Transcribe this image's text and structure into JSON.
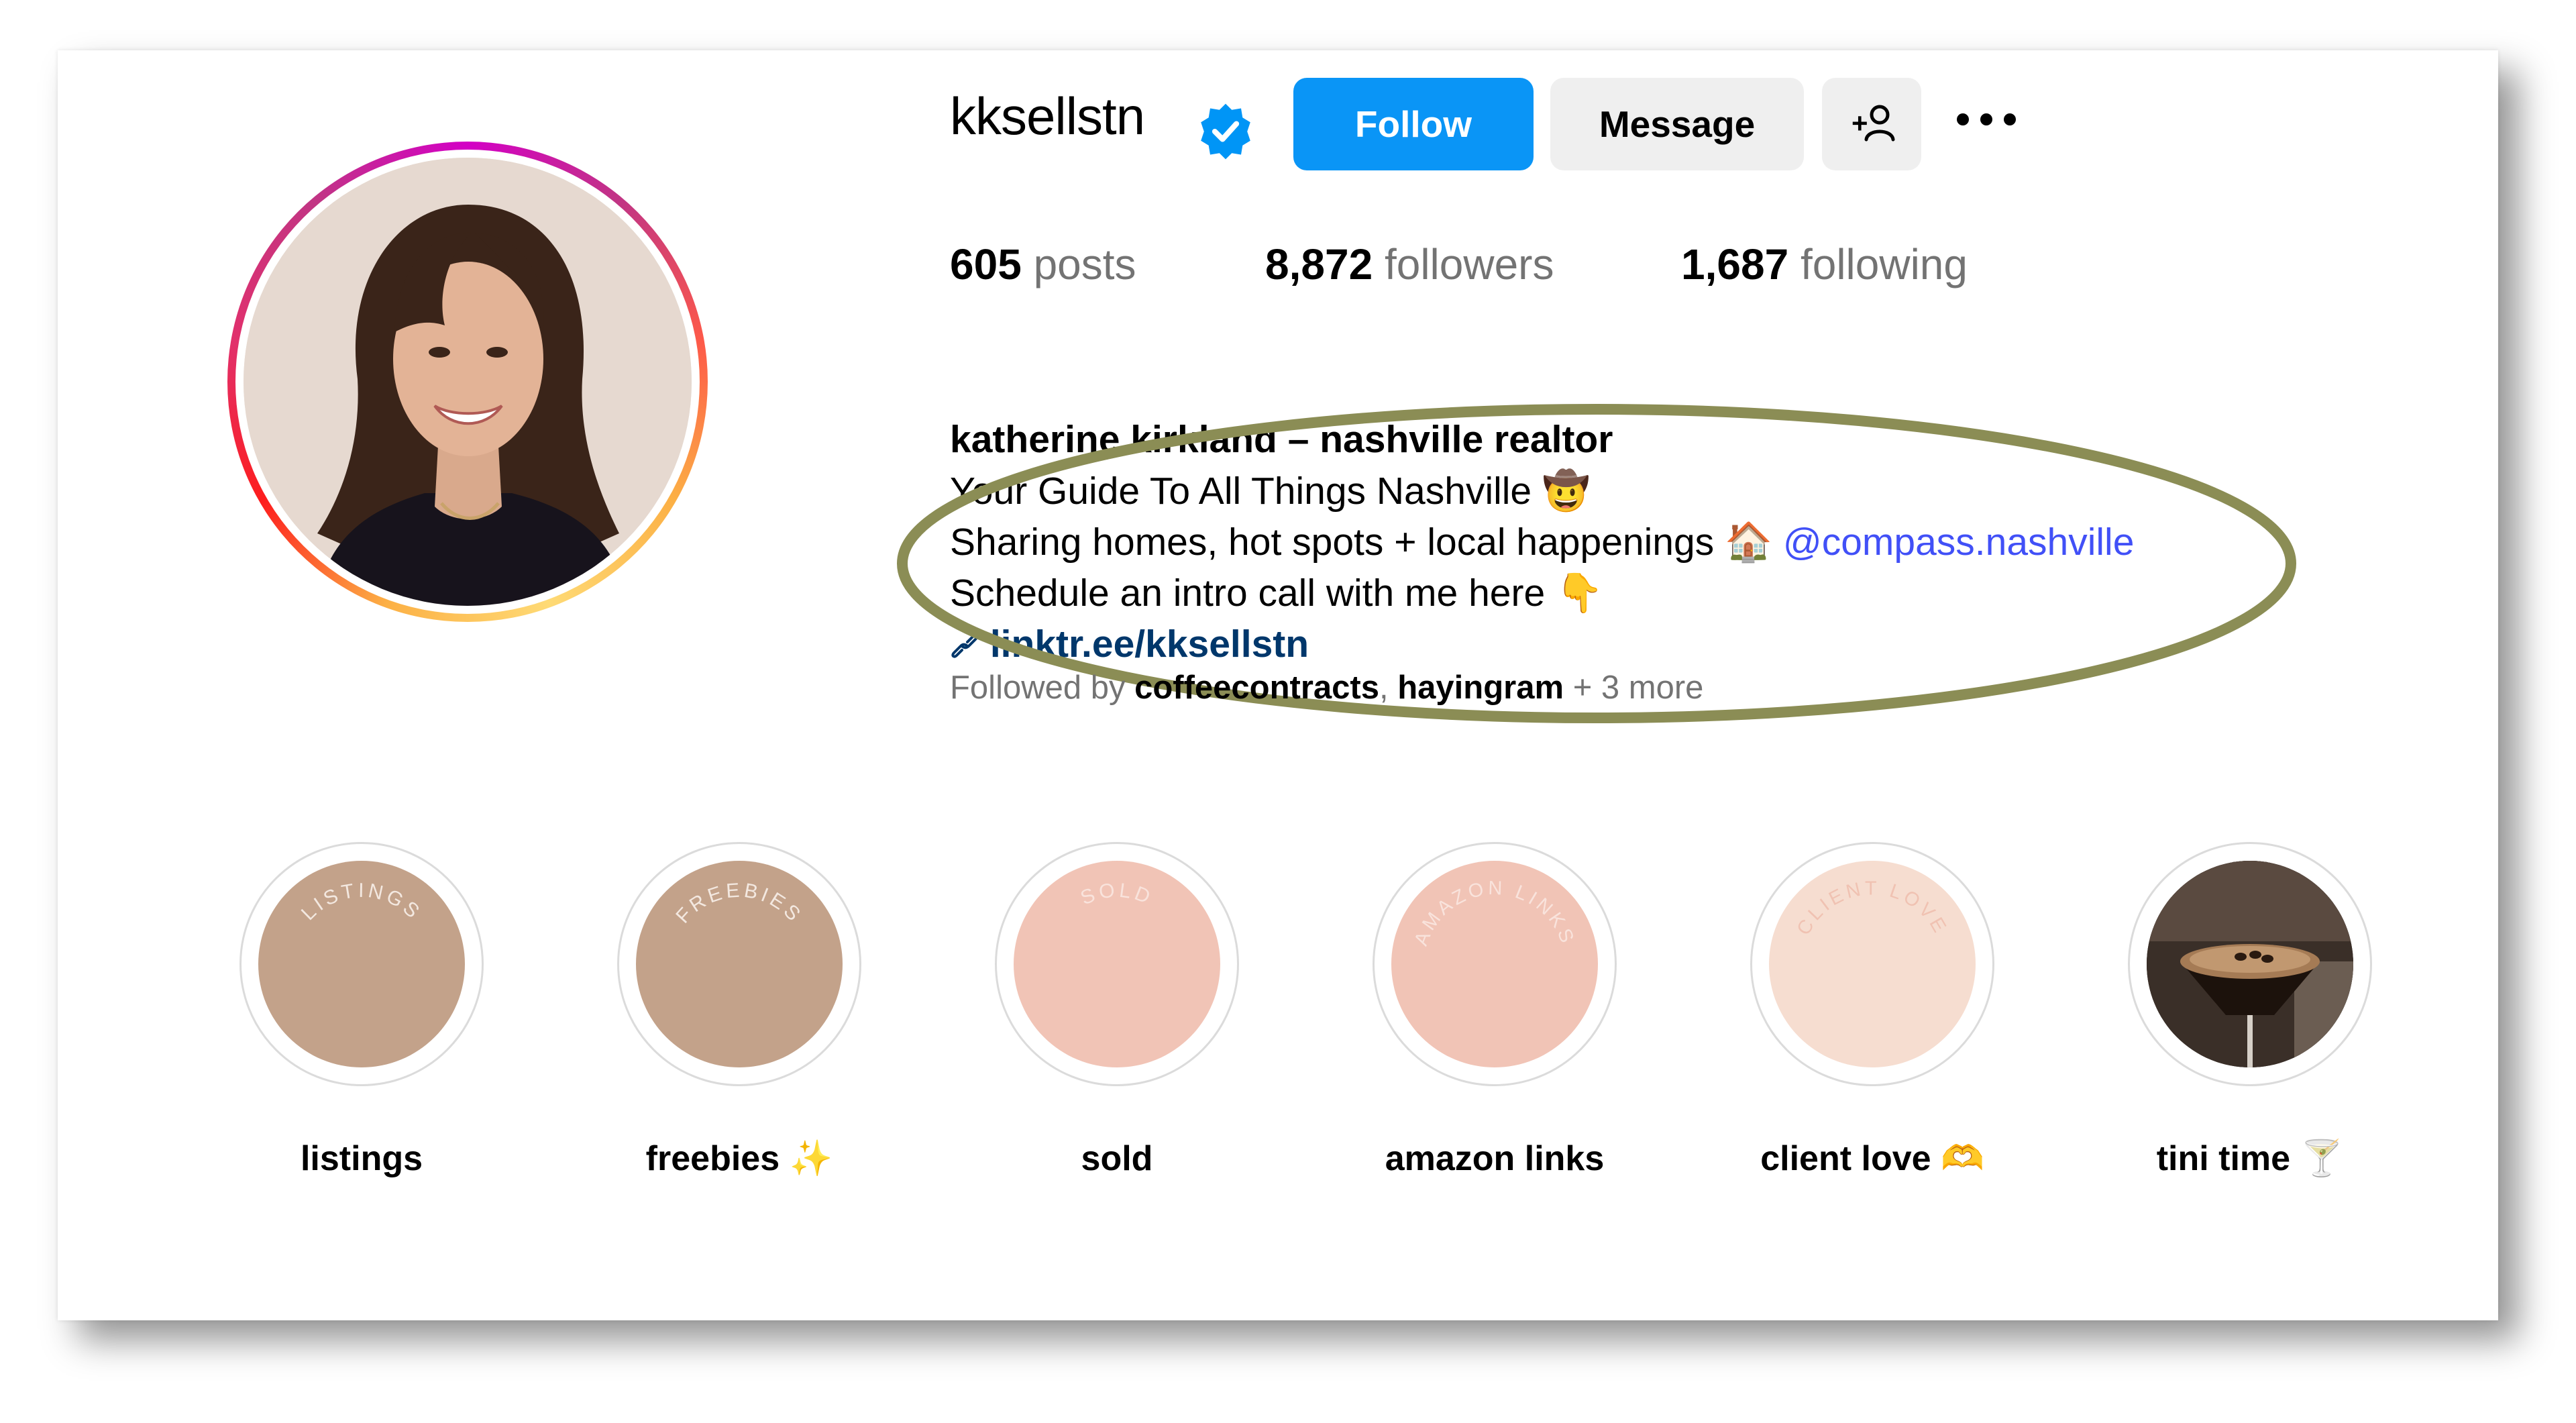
{
  "profile": {
    "username": "kksellstn",
    "follow_label": "Follow",
    "message_label": "Message",
    "stats": [
      {
        "count": "605",
        "label": "posts"
      },
      {
        "count": "8,872",
        "label": "followers"
      },
      {
        "count": "1,687",
        "label": "following"
      }
    ],
    "bio": {
      "name": "katherine kirkland – nashville realtor",
      "line1": "Your Guide To All Things Nashville",
      "line1_emoji": "🤠",
      "line2": "Sharing homes, hot spots + local happenings",
      "line2_emoji": "🏠",
      "mention": "@compass.nashville",
      "line3": "Schedule an intro call with me here",
      "line3_emoji": "👇",
      "link": "linktr.ee/kksellstn"
    },
    "followed_by": {
      "prefix": "Followed by",
      "user1": "coffeecontracts",
      "separator": ",",
      "user2": "hayingram",
      "suffix": "+ 3 more"
    }
  },
  "highlights": [
    {
      "label": "listings",
      "emoji": "",
      "cover_text": "LISTINGS",
      "cover_color": "#c3a28a",
      "text_color": "#f3e8e0"
    },
    {
      "label": "freebies",
      "emoji": "✨",
      "cover_text": "FREEBIES",
      "cover_color": "#c3a28a",
      "text_color": "#f3e8e0"
    },
    {
      "label": "sold",
      "emoji": "",
      "cover_text": "SOLD",
      "cover_color": "#f1c4b6",
      "text_color": "#f9e3dc"
    },
    {
      "label": "amazon links",
      "emoji": "",
      "cover_text": "AMAZON LINKS",
      "cover_color": "#f1c4b6",
      "text_color": "#f9e3dc"
    },
    {
      "label": "client love",
      "emoji": "🫶",
      "cover_text": "CLIENT LOVE",
      "cover_color": "#f6ddd0",
      "text_color": "#f0c2b2"
    },
    {
      "label": "tini time",
      "emoji": "🍸",
      "cover_text": "",
      "cover_color": "#2b221c",
      "text_color": ""
    }
  ],
  "icons": {
    "verified": "verified-badge-icon",
    "add_user": "add-person-icon",
    "more": "more-options-icon",
    "link": "link-icon"
  },
  "colors": {
    "follow_button": "#0a95f6",
    "secondary_button": "#efefef",
    "mention": "#4150f7",
    "link": "#00376b",
    "muted_text": "#737373",
    "annotation_ellipse": "#8b8d55"
  }
}
